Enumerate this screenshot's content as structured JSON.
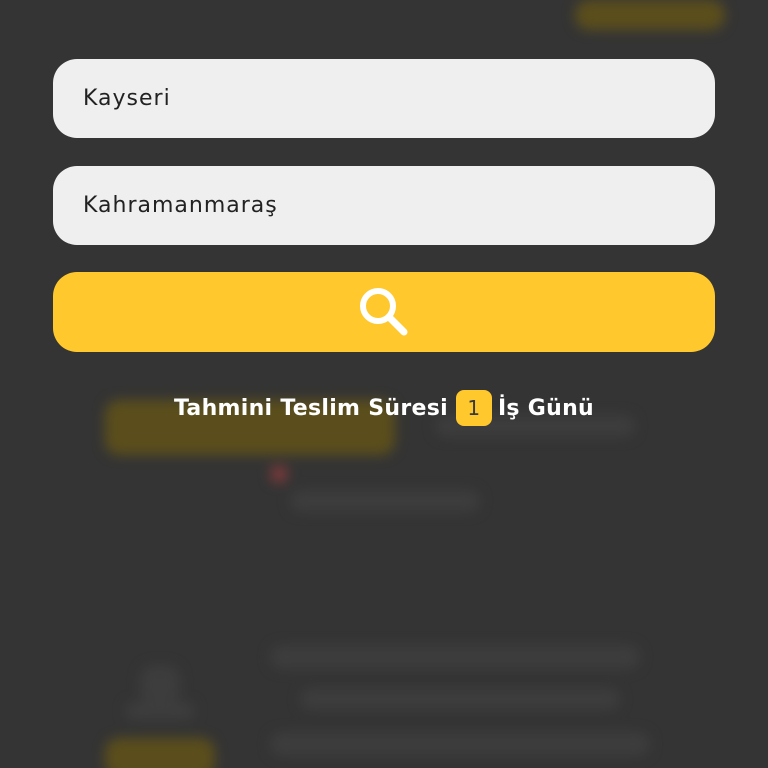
{
  "theme": {
    "background": "#343434",
    "accent": "#FFC82C",
    "field_background": "#EFEFEF"
  },
  "form": {
    "origin_value": "Kayseri",
    "destination_value": "Kahramanmaraş",
    "search_icon": "search-icon"
  },
  "estimate": {
    "prefix": "Tahmini Teslim Süresi",
    "days": "1",
    "suffix": "İş Günü"
  }
}
